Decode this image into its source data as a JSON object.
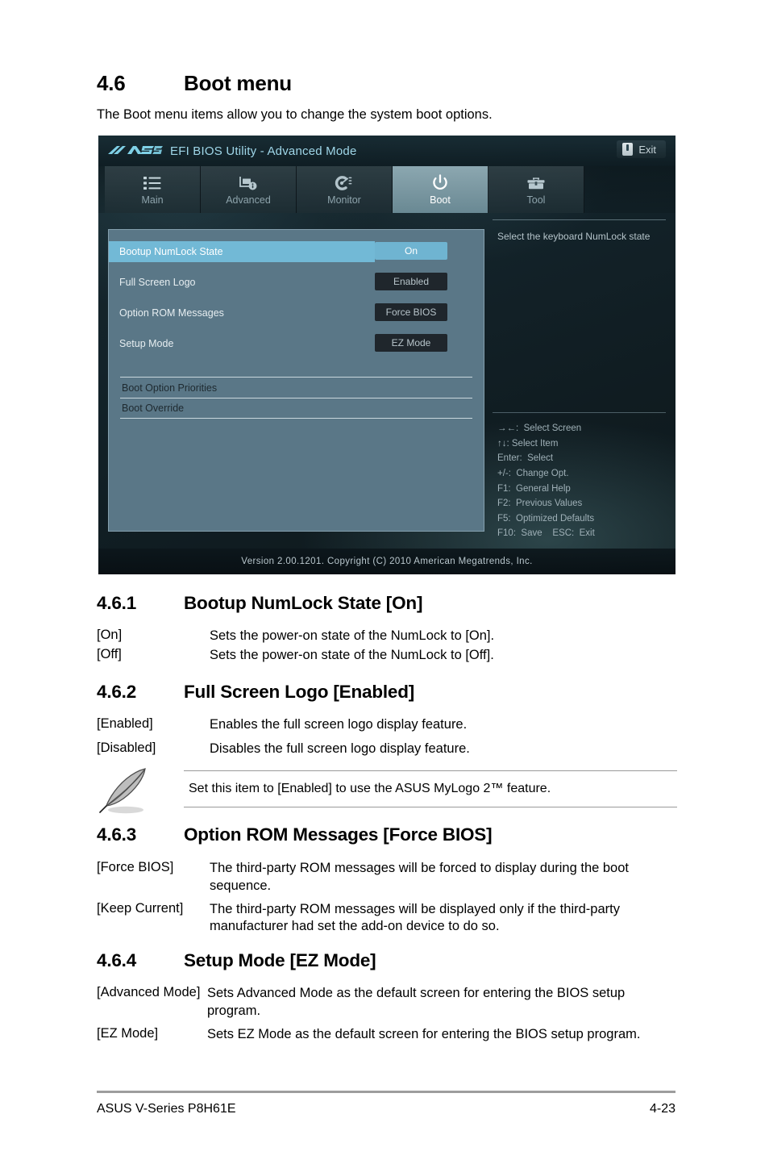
{
  "document": {
    "section": {
      "number": "4.6",
      "title": "Boot menu"
    },
    "intro": "The Boot menu items allow you to change the system boot options.",
    "subsections": [
      {
        "number": "4.6.1",
        "title": "Bootup NumLock State [On]",
        "rows": [
          {
            "term": "[On]",
            "desc": "Sets the power-on state of the NumLock to [On]."
          },
          {
            "term": "[Off]",
            "desc": "Sets the power-on state of the NumLock to [Off]."
          }
        ]
      },
      {
        "number": "4.6.2",
        "title": "Full Screen Logo [Enabled]",
        "rows": [
          {
            "term": "[Enabled]",
            "desc": "Enables the full screen logo display feature."
          },
          {
            "term": "[Disabled]",
            "desc": "Disables the full screen logo display feature."
          }
        ],
        "note": "Set this item to [Enabled] to use the ASUS MyLogo 2™ feature."
      },
      {
        "number": "4.6.3",
        "title": "Option ROM Messages [Force BIOS]",
        "rows": [
          {
            "term": "[Force BIOS]",
            "desc": "The third-party ROM messages will be forced to display during the boot sequence."
          },
          {
            "term": "[Keep Current]",
            "desc": "The third-party ROM messages will be displayed only if the third-party manufacturer had set the add-on device to do so."
          }
        ]
      },
      {
        "number": "4.6.4",
        "title": "Setup Mode [EZ Mode]",
        "rows": [
          {
            "term": "[Advanced Mode]",
            "desc": "Sets Advanced Mode as the default screen for entering the BIOS setup program."
          },
          {
            "term": "[EZ Mode]",
            "desc": "Sets EZ Mode as the default screen for entering the BIOS setup program."
          }
        ]
      }
    ],
    "footer": {
      "left": "ASUS V-Series P8H61E",
      "right": "4-23"
    }
  },
  "bios": {
    "brand": "ASUS",
    "title": "EFI BIOS Utility - Advanced Mode",
    "exit_label": "Exit",
    "tabs": [
      {
        "label": "Main",
        "icon": "list-icon",
        "active": false
      },
      {
        "label": "Advanced",
        "icon": "monitor-info-icon",
        "active": false
      },
      {
        "label": "Monitor",
        "icon": "gauge-icon",
        "active": false
      },
      {
        "label": "Boot",
        "icon": "power-icon",
        "active": true
      },
      {
        "label": "Tool",
        "icon": "toolbox-icon",
        "active": false
      }
    ],
    "settings": [
      {
        "name": "Bootup NumLock State",
        "value": "On",
        "selected": true
      },
      {
        "name": "Full Screen Logo",
        "value": "Enabled",
        "selected": false
      },
      {
        "name": "Option ROM Messages",
        "value": "Force BIOS",
        "selected": false
      },
      {
        "name": "Setup Mode",
        "value": "EZ Mode",
        "selected": false
      }
    ],
    "sub_items": [
      {
        "label": "Boot Option Priorities"
      },
      {
        "label": "Boot Override"
      }
    ],
    "help_text": "Select the keyboard NumLock state",
    "key_legend": [
      "→←:  Select Screen",
      "↑↓: Select Item",
      "Enter:  Select",
      "+/-:  Change Opt.",
      "F1:  General Help",
      "F2:  Previous Values",
      "F5:  Optimized Defaults",
      "F10:  Save    ESC:  Exit"
    ],
    "version_footer": "Version  2.00.1201.   Copyright  (C)  2010  American  Megatrends,  Inc.",
    "colors": {
      "panel": "#5a7787",
      "highlight": "#72b9d6",
      "value_bg": "#1f262c",
      "title_accent": "#9fd6e8"
    }
  }
}
